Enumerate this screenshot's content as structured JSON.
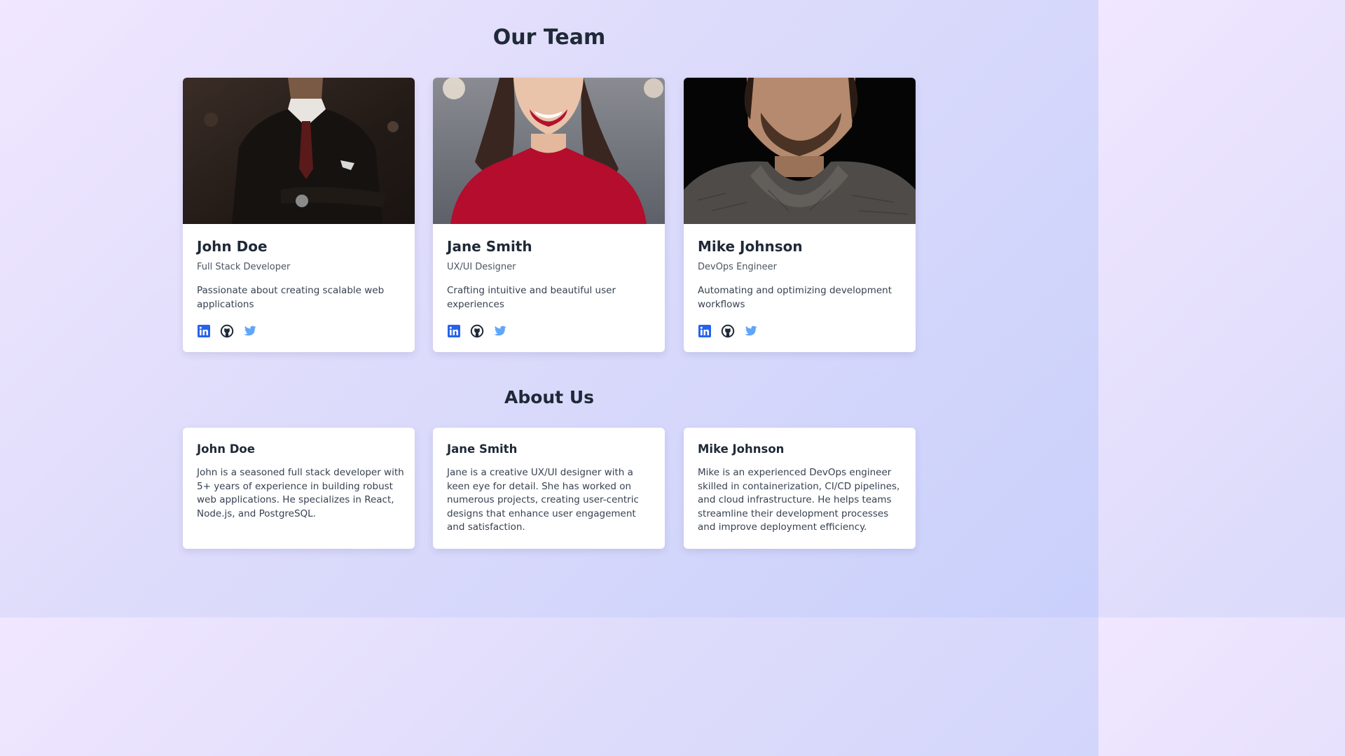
{
  "team_section": {
    "title": "Our Team",
    "members": [
      {
        "name": "John Doe",
        "role": "Full Stack Developer",
        "description": "Passionate about creating scalable web applications",
        "photo": "man-in-dark-suit-photo",
        "socials": [
          "linkedin-icon",
          "github-icon",
          "twitter-icon"
        ]
      },
      {
        "name": "Jane Smith",
        "role": "UX/UI Designer",
        "description": "Crafting intuitive and beautiful user experiences",
        "photo": "smiling-woman-red-sweater-photo",
        "socials": [
          "linkedin-icon",
          "github-icon",
          "twitter-icon"
        ]
      },
      {
        "name": "Mike Johnson",
        "role": "DevOps Engineer",
        "description": "Automating and optimizing development workflows",
        "photo": "bearded-man-knit-sweater-photo",
        "socials": [
          "linkedin-icon",
          "github-icon",
          "twitter-icon"
        ]
      }
    ]
  },
  "about_section": {
    "title": "About Us",
    "entries": [
      {
        "name": "John Doe",
        "text": "John is a seasoned full stack developer with 5+ years of experience in building robust web applications. He specializes in React, Node.js, and PostgreSQL."
      },
      {
        "name": "Jane Smith",
        "text": "Jane is a creative UX/UI designer with a keen eye for detail. She has worked on numerous projects, creating user-centric designs that enhance user engagement and satisfaction."
      },
      {
        "name": "Mike Johnson",
        "text": "Mike is an experienced DevOps engineer skilled in containerization, CI/CD pipelines, and cloud infrastructure. He helps teams streamline their development processes and improve deployment efficiency."
      }
    ]
  },
  "colors": {
    "linkedin": "#2563eb",
    "github": "#1f2937",
    "twitter": "#60a5fa",
    "heading": "#1f2937"
  }
}
